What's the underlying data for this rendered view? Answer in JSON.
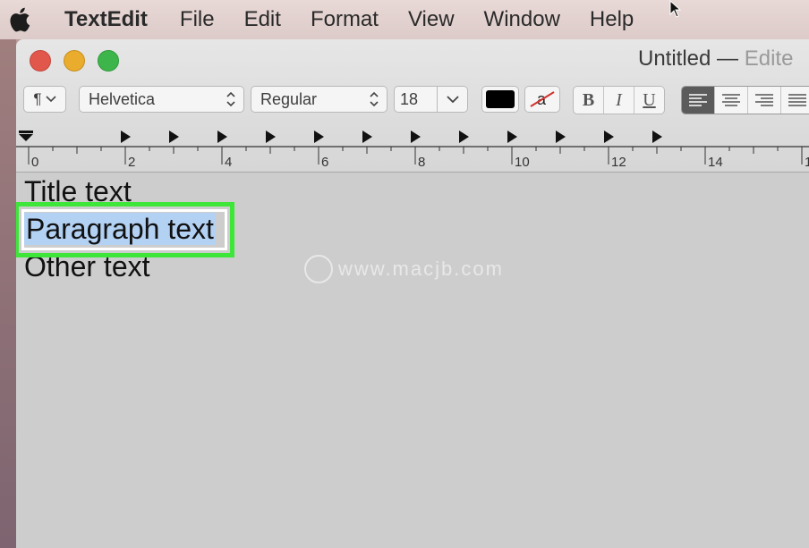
{
  "menubar": {
    "app_name": "TextEdit",
    "items": [
      "File",
      "Edit",
      "Format",
      "View",
      "Window",
      "Help"
    ]
  },
  "window": {
    "title": "Untitled",
    "separator": "—",
    "edited": "Edite"
  },
  "toolbar": {
    "paragraph_symbol": "¶",
    "font": "Helvetica",
    "style": "Regular",
    "size": "18",
    "text_color": "#000000",
    "highlight_glyph": "a",
    "bold": "B",
    "italic": "I",
    "underline": "U"
  },
  "ruler": {
    "labels": [
      "0",
      "2",
      "4",
      "6",
      "8",
      "10",
      "12",
      "14",
      "1"
    ]
  },
  "document": {
    "lines": [
      "Title text",
      "Paragraph text",
      "Other text"
    ]
  },
  "watermark": "www.macjb.com",
  "colors": {
    "highlight_border": "#3ee63a",
    "selection": "#b3d1f3"
  }
}
